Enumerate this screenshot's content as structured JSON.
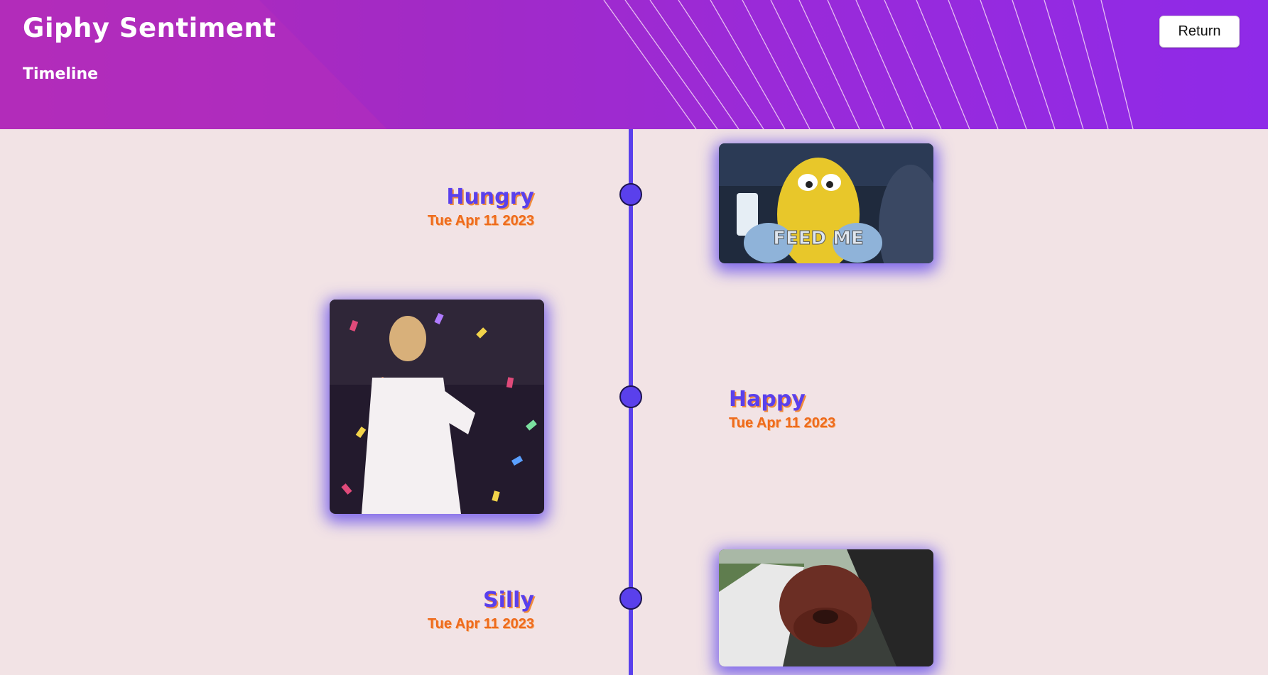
{
  "header": {
    "title": "Giphy Sentiment",
    "subtitle": "Timeline",
    "return_label": "Return"
  },
  "colors": {
    "accent": "#5a40ec",
    "date": "#ee6b1d",
    "background": "#f2e3e5",
    "header_start": "#b02bb8",
    "header_end": "#8f2ae8"
  },
  "timeline": {
    "entries": [
      {
        "emotion": "Hungry",
        "date": "Tue Apr 11 2023",
        "gif_caption": "FEED ME"
      },
      {
        "emotion": "Happy",
        "date": "Tue Apr 11 2023"
      },
      {
        "emotion": "Silly",
        "date": "Tue Apr 11 2023"
      }
    ]
  }
}
